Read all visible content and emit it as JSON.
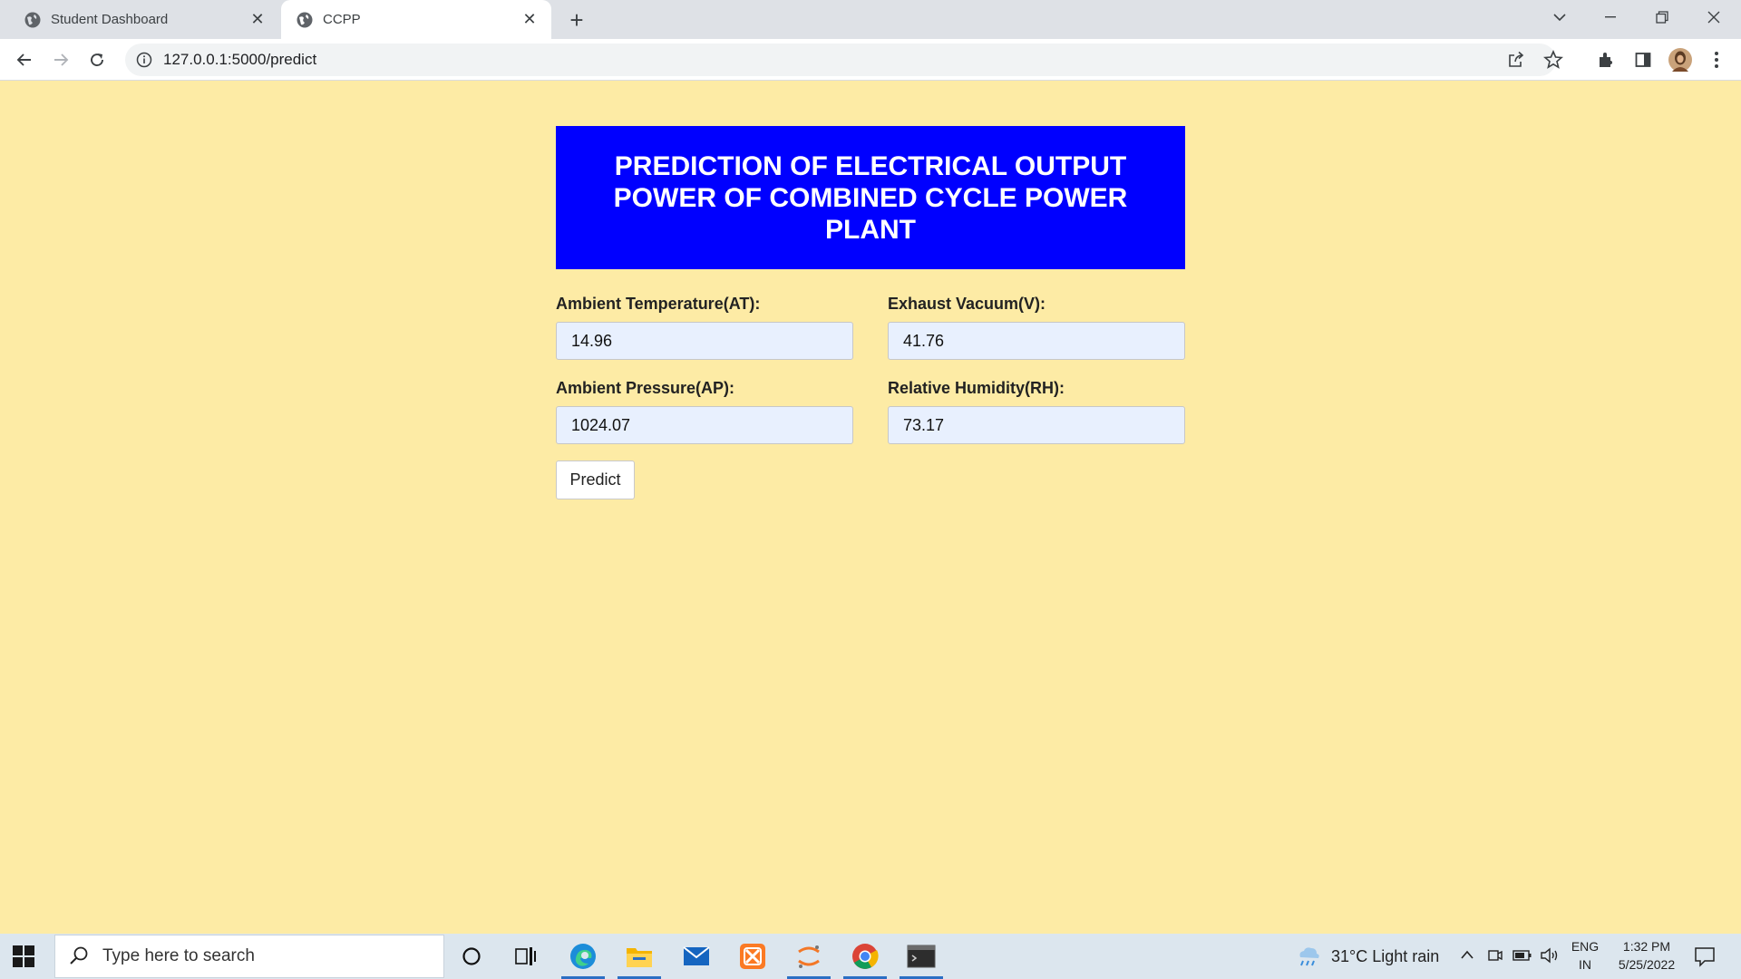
{
  "browser": {
    "tabs": [
      {
        "title": "Student Dashboard",
        "active": false
      },
      {
        "title": "CCPP",
        "active": true
      }
    ],
    "url": "127.0.0.1:5000/predict"
  },
  "page": {
    "banner_title": "PREDICTION OF ELECTRICAL OUTPUT POWER OF COMBINED CYCLE POWER PLANT",
    "fields": {
      "at": {
        "label": "Ambient Temperature(AT):",
        "value": "14.96"
      },
      "v": {
        "label": "Exhaust Vacuum(V):",
        "value": "41.76"
      },
      "ap": {
        "label": "Ambient Pressure(AP):",
        "value": "1024.07"
      },
      "rh": {
        "label": "Relative Humidity(RH):",
        "value": "73.17"
      }
    },
    "predict_label": "Predict"
  },
  "colors": {
    "page_bg": "#fdeba5",
    "banner_bg": "#0000ff",
    "input_bg": "#e8f0fe"
  },
  "taskbar": {
    "search_placeholder": "Type here to search",
    "weather": "31°C  Light rain",
    "lang_top": "ENG",
    "lang_bottom": "IN",
    "time": "1:32 PM",
    "date": "5/25/2022"
  }
}
